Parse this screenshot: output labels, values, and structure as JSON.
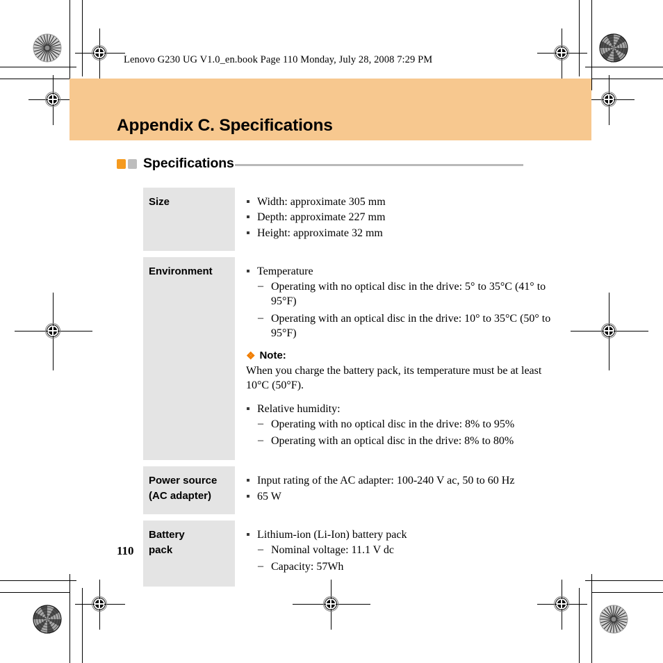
{
  "page": {
    "running_header": "Lenovo G230 UG V1.0_en.book  Page 110  Monday, July 28, 2008  7:29 PM",
    "page_number": "110",
    "banner_title": "Appendix C. Specifications",
    "section_heading": "Specifications",
    "colors": {
      "banner_background": "#f7c88f",
      "accent_orange": "#f59a1e",
      "accent_gray": "#bdbdbd",
      "label_cell_background": "#e4e4e4",
      "rule_gray": "#b9b9b9",
      "note_icon_orange": "#f07d00"
    },
    "icons": {
      "bullet_square": "bullet-square-icon",
      "bullet_dash": "en-dash-icon",
      "note": "orange-diamond-note-icon",
      "heading_square_orange": "orange-square-icon",
      "heading_square_gray": "gray-square-icon",
      "registration": "registration-crosshair-icon",
      "burst": "print-burst-target-icon"
    }
  },
  "spec_table": {
    "rows": [
      {
        "label": "Size",
        "label_lines": [
          "Size"
        ],
        "items": [
          {
            "text": "Width: approximate 305 mm",
            "sub": []
          },
          {
            "text": "Depth: approximate 227 mm",
            "sub": []
          },
          {
            "text": "Height: approximate 32 mm",
            "sub": []
          }
        ],
        "note": null
      },
      {
        "label": "Environment",
        "label_lines": [
          "Environment"
        ],
        "items": [
          {
            "text": "Temperature",
            "sub": [
              "Operating with no optical disc in the drive: 5° to 35°C (41° to 95°F)",
              "Operating with an optical disc in the drive: 10° to 35°C (50° to 95°F)"
            ]
          }
        ],
        "note": {
          "title": "Note:",
          "body": "When you charge the battery pack, its temperature must be at least 10°C (50°F)."
        },
        "items_after_note": [
          {
            "text": "Relative humidity:",
            "sub": [
              "Operating with no optical disc in the drive: 8% to 95%",
              "Operating with an optical disc in the drive: 8% to 80%"
            ]
          }
        ]
      },
      {
        "label": "Power source (AC adapter)",
        "label_lines": [
          "Power source",
          "(AC adapter)"
        ],
        "items": [
          {
            "text": "Input rating of the AC adapter: 100-240 V ac, 50 to 60 Hz",
            "sub": []
          },
          {
            "text": "65 W",
            "sub": []
          }
        ],
        "note": null
      },
      {
        "label": "Battery pack",
        "label_lines": [
          "Battery",
          "pack"
        ],
        "items": [
          {
            "text": "Lithium-ion (Li-Ion) battery pack",
            "sub": [
              "Nominal voltage: 11.1 V dc",
              "Capacity: 57Wh"
            ]
          }
        ],
        "note": null
      }
    ]
  }
}
